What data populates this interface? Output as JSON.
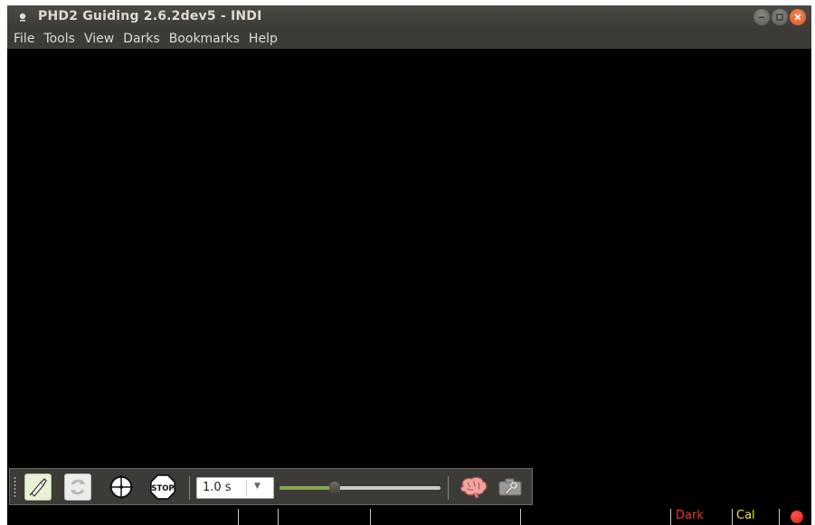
{
  "window": {
    "title": "PHD2 Guiding 2.6.2dev5 - INDI"
  },
  "menubar": {
    "items": [
      "File",
      "Tools",
      "View",
      "Darks",
      "Bookmarks",
      "Help"
    ]
  },
  "toolbar": {
    "exposure_value": "1.0 s",
    "gamma_slider_fraction": 0.34,
    "buttons": {
      "loop": "loop-icon",
      "cycle": "cycle-icon",
      "guide": "crosshair-icon",
      "stop": "STOP",
      "brain": "brain-icon",
      "camera": "camera-settings-icon"
    }
  },
  "statusbar": {
    "dark_label": "Dark",
    "cal_label": "Cal",
    "dark_color": "#e53a2c",
    "cal_color": "#e9e04a",
    "status_led_color": "#e0261a"
  },
  "colors": {
    "titlebar": "#3c3b37",
    "canvas": "#000000",
    "slider_fill": "#87a752",
    "close_button": "#e25a25"
  }
}
